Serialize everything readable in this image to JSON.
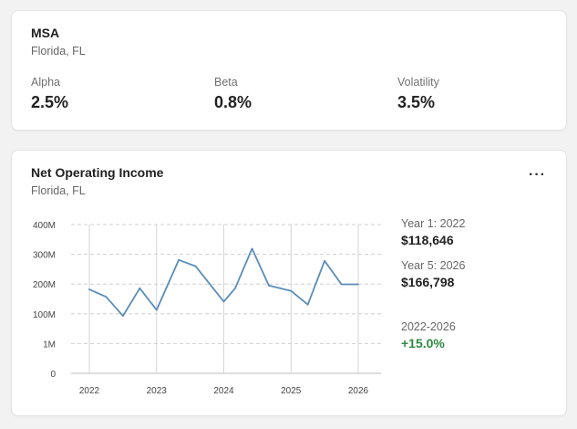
{
  "msa_card": {
    "title": "MSA",
    "location": "Florida, FL",
    "metrics": [
      {
        "label": "Alpha",
        "value": "2.5%"
      },
      {
        "label": "Beta",
        "value": "0.8%"
      },
      {
        "label": "Volatility",
        "value": "3.5%"
      }
    ]
  },
  "noi_card": {
    "title": "Net Operating Income",
    "location": "Florida, FL",
    "menu_label": "···",
    "year1_label": "Year 1: 2022",
    "year1_value": "$118,646",
    "year5_label": "Year 5: 2026",
    "year5_value": "$166,798",
    "range_label": "2022-2026",
    "range_value": "+15.0%"
  },
  "colors": {
    "line": "#5b8db8",
    "positive": "#2e8b43",
    "grid": "#cfcfcf"
  },
  "chart_data": {
    "type": "line",
    "title": "",
    "xlabel": "",
    "ylabel": "",
    "y_tick_labels": [
      "0",
      "1M",
      "100M",
      "200M",
      "300M",
      "400M"
    ],
    "x_tick_labels": [
      "2022",
      "2023",
      "2024",
      "2025",
      "2026"
    ],
    "series": [
      {
        "name": "",
        "x": [
          2022.0,
          2022.25,
          2022.5,
          2022.75,
          2023.0,
          2023.33,
          2023.58,
          2023.83,
          2024.0,
          2024.17,
          2024.42,
          2024.67,
          2025.0,
          2025.25,
          2025.5,
          2025.75,
          2026.0
        ],
        "y": [
          182,
          157,
          93,
          186,
          113,
          281,
          260,
          189,
          141,
          186,
          319,
          195,
          177,
          131,
          278,
          199,
          199
        ]
      }
    ],
    "y_scale": "categorical ticks (0, 1M, 100M, 200M, 300M, 400M)",
    "grid": "dashed horizontal, solid vertical at years",
    "legend": "none"
  }
}
